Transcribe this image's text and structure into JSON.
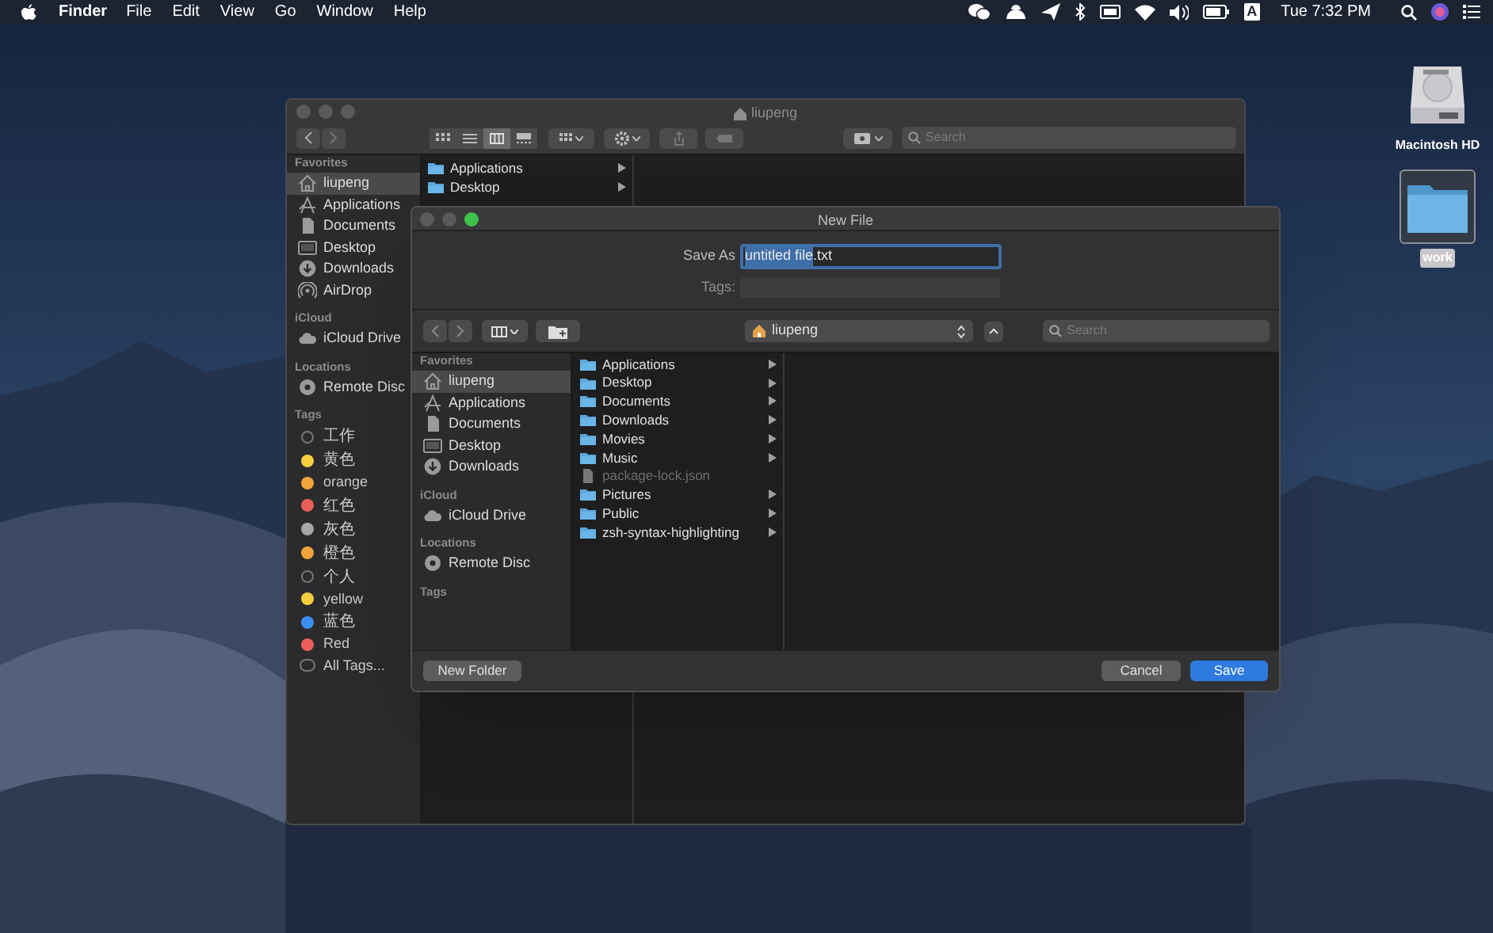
{
  "menu_bar": {
    "app": "Finder",
    "menus": [
      "File",
      "Edit",
      "View",
      "Go",
      "Window",
      "Help"
    ],
    "input_source": "A",
    "clock": "Tue 7:32 PM"
  },
  "desktop_icons": [
    {
      "label": "Macintosh HD",
      "kind": "drive",
      "selected": false
    },
    {
      "label": "work",
      "kind": "folder",
      "selected": true
    }
  ],
  "finder_window": {
    "title": "liupeng",
    "search": {
      "placeholder": "Search"
    },
    "sidebar": [
      {
        "heading": "Favorites",
        "items": [
          {
            "label": "liupeng",
            "kind": "home",
            "selected": true
          },
          {
            "label": "Applications",
            "kind": "apps",
            "selected": false
          },
          {
            "label": "Documents",
            "kind": "document",
            "selected": false
          },
          {
            "label": "Desktop",
            "kind": "desktop",
            "selected": false
          },
          {
            "label": "Downloads",
            "kind": "download",
            "selected": false
          },
          {
            "label": "AirDrop",
            "kind": "airdrop",
            "selected": false
          }
        ]
      },
      {
        "heading": "iCloud",
        "items": [
          {
            "label": "iCloud Drive",
            "kind": "cloud",
            "selected": false
          }
        ]
      },
      {
        "heading": "Locations",
        "items": [
          {
            "label": "Remote Disc",
            "kind": "disc",
            "selected": false
          }
        ]
      },
      {
        "heading": "Tags",
        "items": [
          {
            "label": "工作",
            "kind": "ring",
            "selected": false
          },
          {
            "label": "黄色",
            "kind": "dot",
            "color": "#f5cf3f",
            "selected": false
          },
          {
            "label": "orange",
            "kind": "dot",
            "color": "#f2a33b",
            "selected": false
          },
          {
            "label": "红色",
            "kind": "dot",
            "color": "#ec5f58",
            "selected": false
          },
          {
            "label": "灰色",
            "kind": "dot",
            "color": "#a8a8ab",
            "selected": false
          },
          {
            "label": "橙色",
            "kind": "dot",
            "color": "#f2a33b",
            "selected": false
          },
          {
            "label": "个人",
            "kind": "ring",
            "selected": false
          },
          {
            "label": "yellow",
            "kind": "dot",
            "color": "#f5cf3f",
            "selected": false
          },
          {
            "label": "蓝色",
            "kind": "dot",
            "color": "#3b8ff0",
            "selected": false
          },
          {
            "label": "Red",
            "kind": "dot",
            "color": "#ec5f58",
            "selected": false
          },
          {
            "label": "All Tags...",
            "kind": "all",
            "selected": false
          }
        ]
      }
    ],
    "column_items": [
      {
        "label": "Applications",
        "kind": "folder"
      },
      {
        "label": "Desktop",
        "kind": "folder"
      }
    ]
  },
  "save_dialog": {
    "title": "New File",
    "save_as": {
      "label": "Save As",
      "value_parts": [
        {
          "text": "untitled file",
          "selected": true
        },
        {
          "text": ".txt",
          "selected": false
        }
      ]
    },
    "tags": {
      "label": "Tags:"
    },
    "location": "liupeng",
    "search": {
      "placeholder": "Search"
    },
    "sidebar": [
      {
        "heading": "Favorites",
        "items": [
          {
            "label": "liupeng",
            "kind": "home",
            "selected": true
          },
          {
            "label": "Applications",
            "kind": "apps",
            "selected": false
          },
          {
            "label": "Documents",
            "kind": "document",
            "selected": false
          },
          {
            "label": "Desktop",
            "kind": "desktop",
            "selected": false
          },
          {
            "label": "Downloads",
            "kind": "download",
            "selected": false
          }
        ]
      },
      {
        "heading": "iCloud",
        "items": [
          {
            "label": "iCloud Drive",
            "kind": "cloud",
            "selected": false
          }
        ]
      },
      {
        "heading": "Locations",
        "items": [
          {
            "label": "Remote Disc",
            "kind": "disc",
            "selected": false
          }
        ]
      },
      {
        "heading": "Tags"
      }
    ],
    "files": [
      {
        "label": "Applications",
        "kind": "folder",
        "disabled": false
      },
      {
        "label": "Desktop",
        "kind": "folder",
        "disabled": false
      },
      {
        "label": "Documents",
        "kind": "folder",
        "disabled": false
      },
      {
        "label": "Downloads",
        "kind": "folder",
        "disabled": false
      },
      {
        "label": "Movies",
        "kind": "folder",
        "disabled": false
      },
      {
        "label": "Music",
        "kind": "folder",
        "disabled": false
      },
      {
        "label": "package-lock.json",
        "kind": "file",
        "disabled": true
      },
      {
        "label": "Pictures",
        "kind": "folder",
        "disabled": false
      },
      {
        "label": "Public",
        "kind": "folder",
        "disabled": false
      },
      {
        "label": "zsh-syntax-highlighting",
        "kind": "folder",
        "disabled": false
      }
    ],
    "buttons": [
      {
        "label": "New Folder",
        "kind": "secondary"
      },
      {
        "label": "Cancel",
        "kind": "normal"
      },
      {
        "label": "Save",
        "kind": "default"
      }
    ]
  }
}
